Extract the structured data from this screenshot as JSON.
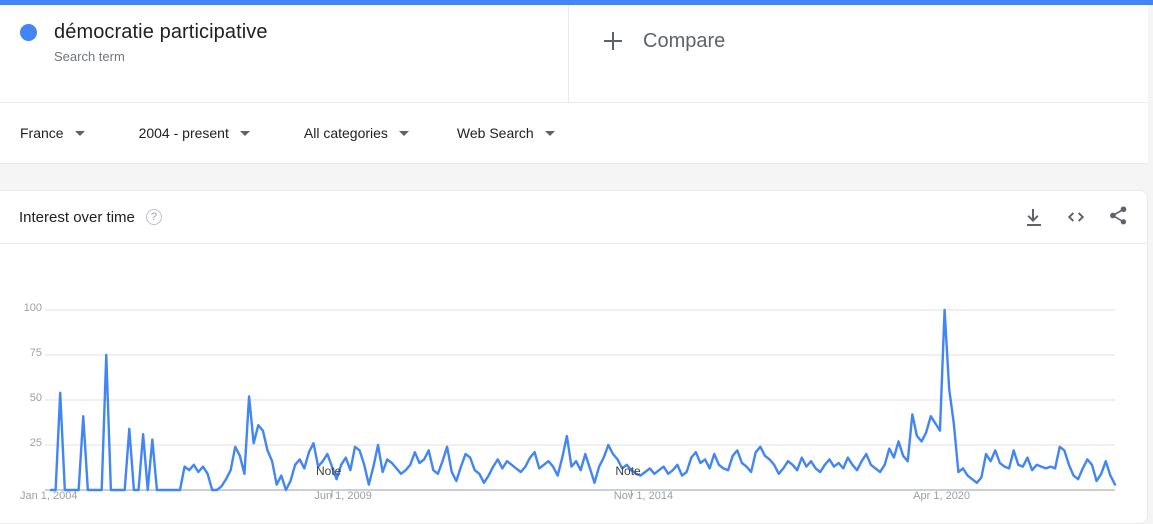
{
  "theme": {
    "accent": "#4285f4",
    "line_color": "#4285f4",
    "page_bg": "#f5f5f5",
    "card_bg": "#ffffff",
    "grid_color": "#e0e0e0",
    "muted_text": "#9aa0a6"
  },
  "search": {
    "term": "démocratie participative",
    "type_label": "Search term",
    "dot_color": "#4285f4"
  },
  "compare": {
    "label": "Compare",
    "icon": "plus-icon"
  },
  "filters": [
    {
      "name": "location",
      "label": "France"
    },
    {
      "name": "time-range",
      "label": "2004 - present"
    },
    {
      "name": "category",
      "label": "All categories"
    },
    {
      "name": "search-type",
      "label": "Web Search"
    }
  ],
  "panel": {
    "title": "Interest over time",
    "help_icon": "?",
    "actions": [
      {
        "name": "download-icon",
        "label": "Download"
      },
      {
        "name": "embed-icon",
        "label": "Embed"
      },
      {
        "name": "share-icon",
        "label": "Share"
      }
    ]
  },
  "chart_data": {
    "type": "line",
    "title": "Interest over time",
    "xlabel": "",
    "ylabel": "",
    "ylim": [
      0,
      100
    ],
    "yticks": [
      25,
      50,
      75,
      100
    ],
    "grid": true,
    "legend": false,
    "series_name": "démocratie participative",
    "color": "#4285f4",
    "x_tick_labels": [
      "Jan 1, 2004",
      "Jun 1, 2009",
      "Nov 1, 2014",
      "Apr 1, 2020"
    ],
    "x_tick_indices": [
      0,
      65,
      130,
      195
    ],
    "annotations": [
      {
        "label": "Note",
        "index": 61
      },
      {
        "label": "Note",
        "index": 126
      }
    ],
    "x_start": "2004-01",
    "x_end": "2023-06",
    "x_interval": "month",
    "values": [
      0,
      0,
      54,
      0,
      0,
      0,
      0,
      41,
      0,
      0,
      0,
      0,
      75,
      0,
      0,
      0,
      0,
      34,
      0,
      0,
      31,
      0,
      28,
      0,
      0,
      0,
      0,
      0,
      0,
      13,
      11,
      14,
      10,
      13,
      9,
      0,
      0,
      2,
      6,
      11,
      24,
      19,
      9,
      52,
      26,
      36,
      33,
      22,
      16,
      3,
      8,
      0,
      5,
      14,
      17,
      12,
      21,
      26,
      13,
      16,
      20,
      13,
      6,
      14,
      18,
      11,
      24,
      22,
      14,
      3,
      13,
      25,
      10,
      17,
      15,
      12,
      9,
      11,
      14,
      21,
      15,
      17,
      22,
      11,
      9,
      16,
      24,
      10,
      5,
      13,
      20,
      18,
      11,
      9,
      4,
      8,
      13,
      17,
      12,
      16,
      14,
      12,
      10,
      13,
      18,
      21,
      12,
      14,
      16,
      13,
      8,
      18,
      30,
      13,
      16,
      11,
      20,
      12,
      4,
      13,
      18,
      25,
      20,
      17,
      12,
      14,
      11,
      9,
      8,
      10,
      12,
      9,
      11,
      13,
      9,
      11,
      14,
      8,
      10,
      18,
      21,
      15,
      17,
      12,
      20,
      14,
      12,
      11,
      19,
      22,
      15,
      13,
      10,
      21,
      24,
      19,
      17,
      14,
      9,
      12,
      16,
      14,
      11,
      18,
      13,
      16,
      12,
      10,
      14,
      17,
      13,
      15,
      12,
      18,
      14,
      11,
      16,
      20,
      14,
      12,
      10,
      14,
      23,
      18,
      27,
      19,
      16,
      42,
      30,
      27,
      32,
      41,
      37,
      33,
      100,
      56,
      37,
      10,
      12,
      8,
      6,
      4,
      7,
      20,
      16,
      22,
      15,
      13,
      12,
      22,
      14,
      13,
      18,
      11,
      14,
      13,
      12,
      13,
      12,
      24,
      22,
      14,
      8,
      6,
      12,
      17,
      14,
      5,
      9,
      16,
      8,
      3
    ]
  }
}
